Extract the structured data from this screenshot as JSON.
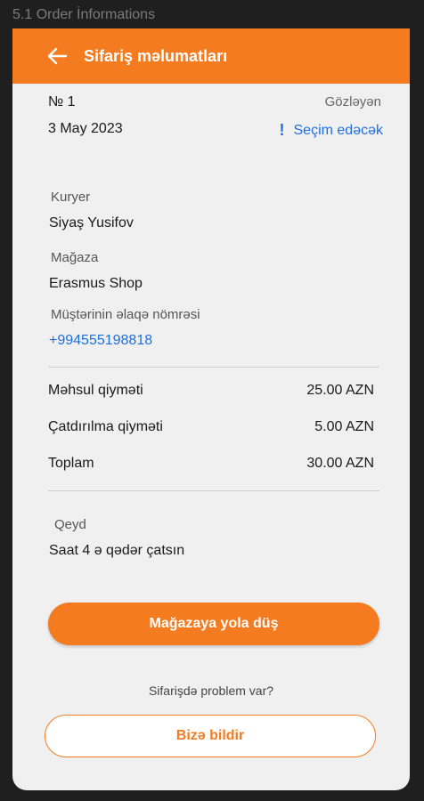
{
  "caption": "5.1 Order İnformations",
  "appbar": {
    "title": "Sifariş məlumatları"
  },
  "order": {
    "number": "№ 1",
    "date": "3 May 2023",
    "status": "Gözləyən",
    "choice_icon": "!",
    "choice_text": "Seçim edəcək"
  },
  "courier": {
    "label": "Kuryer",
    "name": "Siyaş Yusifov"
  },
  "store": {
    "label": "Mağaza",
    "name": "Erasmus Shop"
  },
  "contact": {
    "label": "Müştərinin əlaqə nömrəsi",
    "phone": "+994555198818"
  },
  "prices": [
    {
      "label": "Məhsul qiyməti",
      "value": "25.00 AZN"
    },
    {
      "label": "Çatdırılma qiyməti",
      "value": "5.00 AZN"
    },
    {
      "label": "Toplam",
      "value": "30.00 AZN"
    }
  ],
  "note": {
    "label": "Qeyd",
    "text": "Saat 4 ə qədər çatsın"
  },
  "actions": {
    "primary_label": "Mağazaya yola düş",
    "problem_text": "Sifarişdə problem var?",
    "report_label": "Bizə bildir"
  },
  "colors": {
    "accent": "#f47b20",
    "link": "#1e6fe0",
    "background": "#f0f0f0"
  }
}
